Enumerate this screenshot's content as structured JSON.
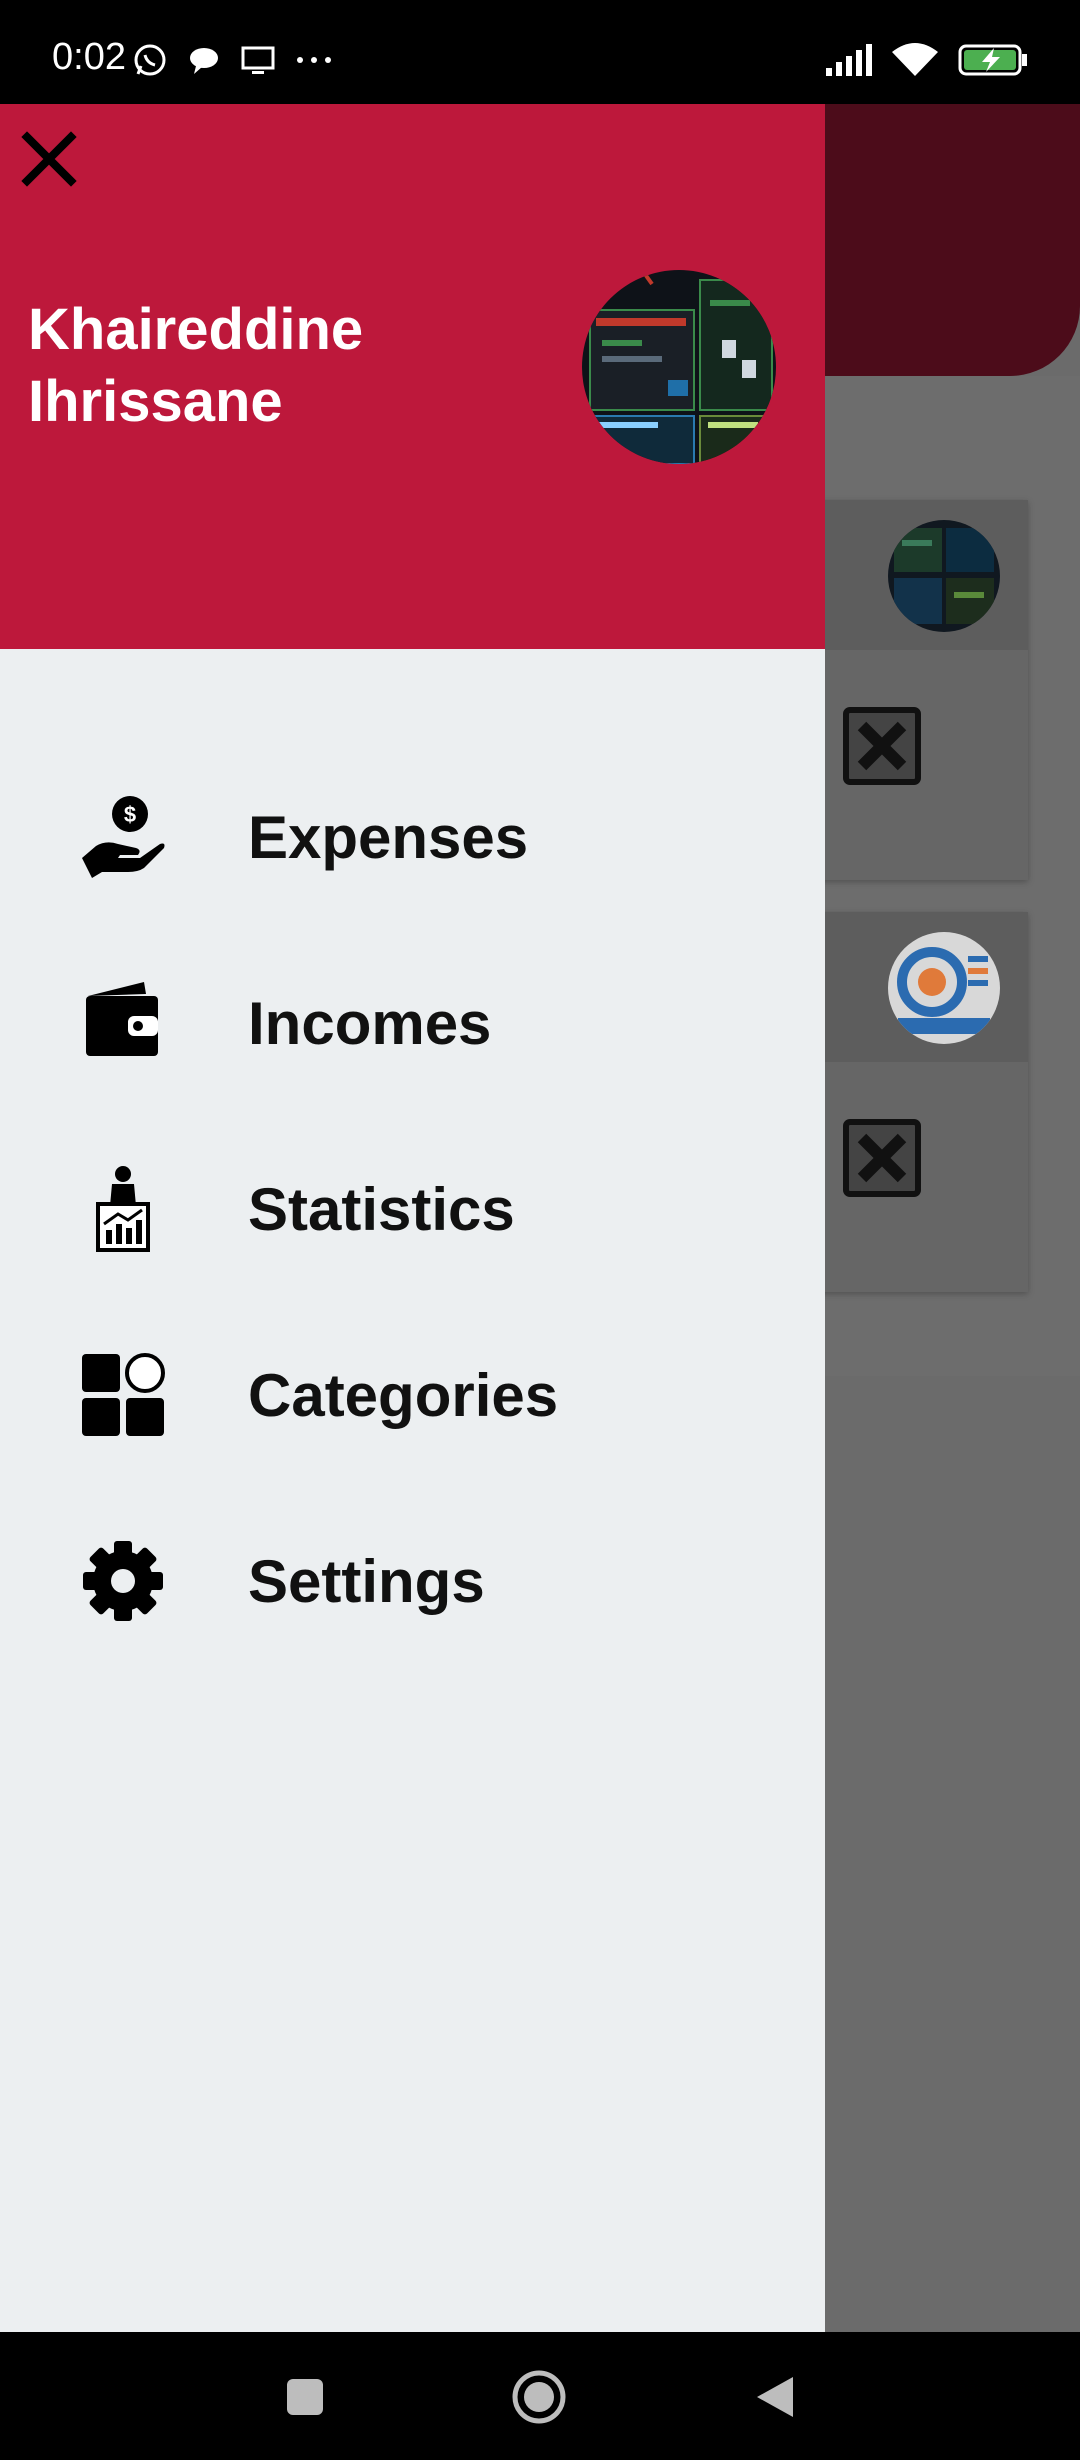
{
  "status_bar": {
    "time": "0:02",
    "left_icons": [
      "whatsapp-icon",
      "chat-bubble-icon",
      "screen-icon",
      "more-dots-icon"
    ],
    "right_icons": [
      "signal-icon",
      "wifi-icon",
      "battery-charging-icon"
    ]
  },
  "drawer": {
    "user_name": "Khaireddine Ihrissane",
    "menu_items": [
      {
        "label": "Expenses",
        "icon": "hand-dollar-icon"
      },
      {
        "label": "Incomes",
        "icon": "wallet-icon"
      },
      {
        "label": "Statistics",
        "icon": "statistics-icon"
      },
      {
        "label": "Categories",
        "icon": "categories-icon"
      },
      {
        "label": "Settings",
        "icon": "gear-icon"
      }
    ]
  },
  "colors": {
    "drawer_header": "#bd183b",
    "drawer_bg": "#eceff1",
    "background_scrim": "#6b6b6b"
  },
  "navbar": {
    "buttons": [
      "recents-button",
      "home-button",
      "back-button"
    ]
  }
}
